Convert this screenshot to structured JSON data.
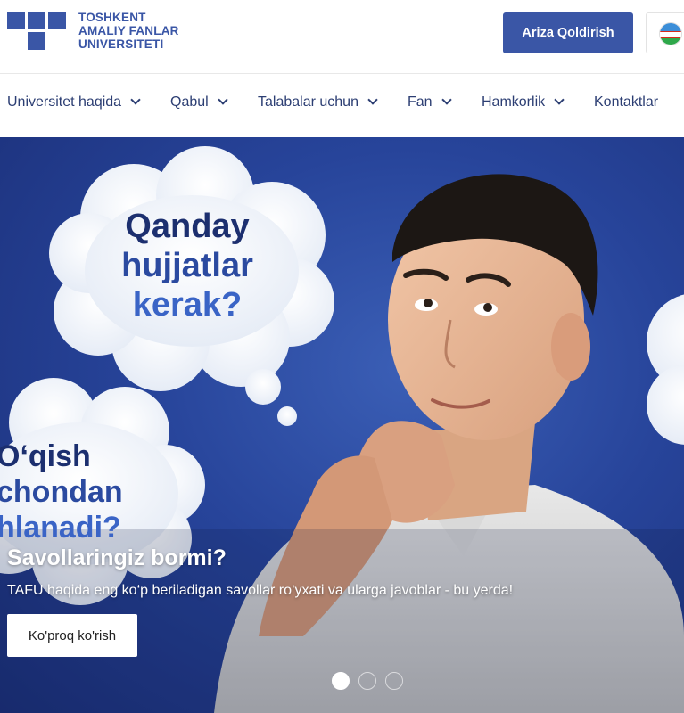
{
  "brand": {
    "logo_line1": "TOSHKENT",
    "logo_line2": "AMALIY FANLAR",
    "logo_line3": "UNIVERSITETI",
    "color": "#3a56a6"
  },
  "header": {
    "apply_label": "Ariza Qoldirish",
    "language_flag": "uzbekistan-flag-icon"
  },
  "nav": {
    "items": [
      {
        "label": "Universitet haqida",
        "has_dropdown": true
      },
      {
        "label": "Qabul",
        "has_dropdown": true
      },
      {
        "label": "Talabalar uchun",
        "has_dropdown": true
      },
      {
        "label": "Fan",
        "has_dropdown": true
      },
      {
        "label": "Hamkorlik",
        "has_dropdown": true
      },
      {
        "label": "Kontaktlar",
        "has_dropdown": false
      }
    ]
  },
  "hero": {
    "bubble1": [
      "Qanday",
      "hujjatlar",
      "kerak?"
    ],
    "bubble2": [
      "O‘qish",
      "chondan",
      "hlanadi?"
    ],
    "title": "Savollaringiz bormi?",
    "text": "TAFU haqida eng ko‘p beriladigan savollar ro‘yxati va ularga javoblar - bu yerda!",
    "cta_label": "Ko'proq ko'rish",
    "slides_total": 3,
    "active_slide": 1
  }
}
